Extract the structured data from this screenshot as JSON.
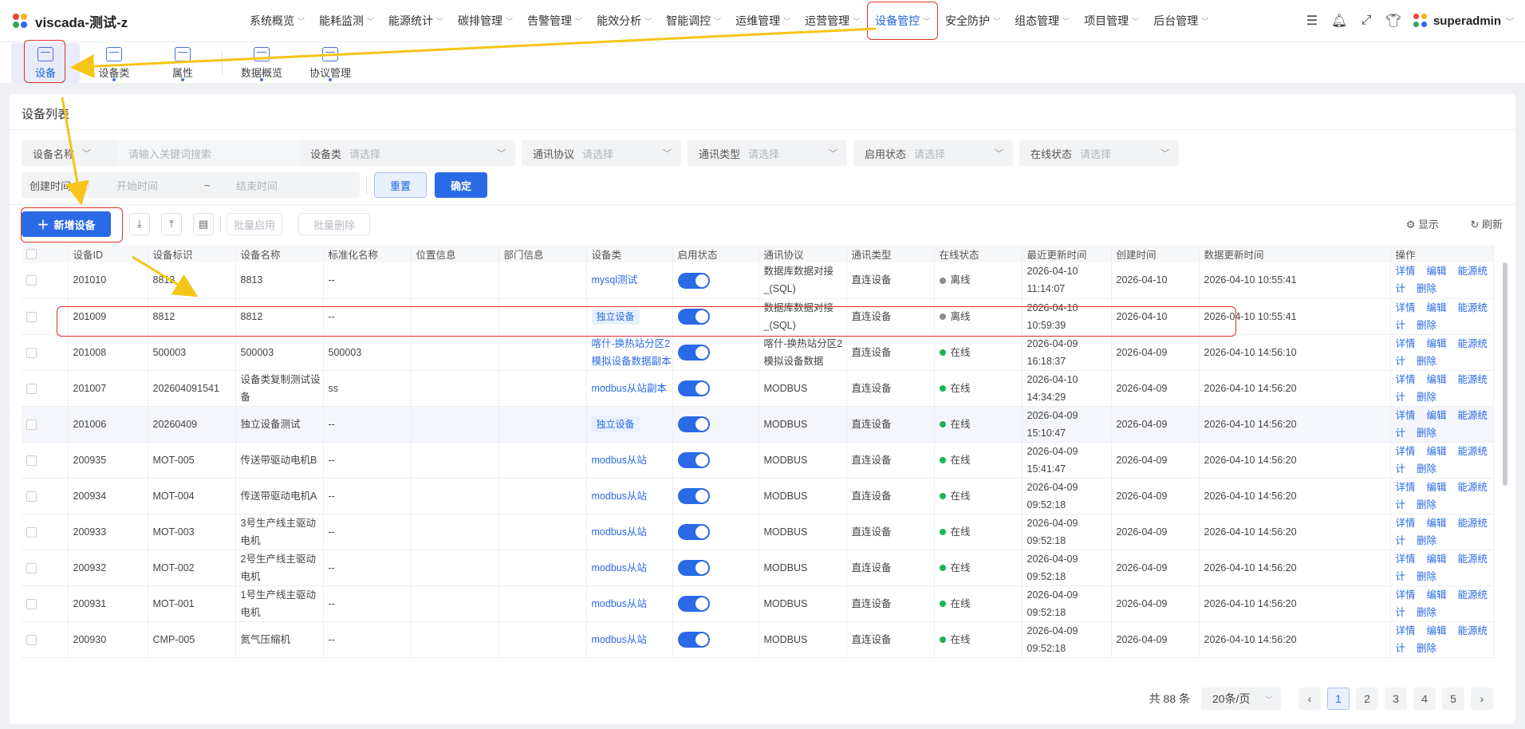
{
  "app": {
    "title": "viscada-测试-z",
    "user": "superadmin"
  },
  "nav": [
    {
      "label": "系统概览"
    },
    {
      "label": "能耗监测"
    },
    {
      "label": "能源统计"
    },
    {
      "label": "碳排管理"
    },
    {
      "label": "告警管理"
    },
    {
      "label": "能效分析"
    },
    {
      "label": "智能调控"
    },
    {
      "label": "运维管理"
    },
    {
      "label": "运营管理"
    },
    {
      "label": "设备管控",
      "active": true
    },
    {
      "label": "安全防护"
    },
    {
      "label": "组态管理"
    },
    {
      "label": "项目管理"
    },
    {
      "label": "后台管理"
    }
  ],
  "top_tools": [
    "list-icon",
    "bell-icon",
    "fullscreen-icon",
    "shirt-icon"
  ],
  "subnav": [
    {
      "label": "设备",
      "active": true
    },
    {
      "label": "设备类"
    },
    {
      "label": "属性"
    },
    {
      "label": "数据概览"
    },
    {
      "label": "协议管理"
    }
  ],
  "panel": {
    "title": "设备列表"
  },
  "filters": {
    "name_select": "设备名称",
    "keyword_placeholder": "请输入关键词搜索",
    "device_class": {
      "label": "设备类",
      "placeholder": "请选择"
    },
    "protocol": {
      "label": "通讯协议",
      "placeholder": "请选择"
    },
    "comm_type": {
      "label": "通讯类型",
      "placeholder": "请选择"
    },
    "enable_state": {
      "label": "启用状态",
      "placeholder": "请选择"
    },
    "online_state": {
      "label": "在线状态",
      "placeholder": "请选择"
    },
    "created": {
      "label": "创建时间",
      "start": "开始时间",
      "sep": "~",
      "end": "结束时间"
    },
    "reset": "重置",
    "confirm": "确定"
  },
  "toolbar": {
    "add": "新增设备",
    "batch_enable": "批量启用",
    "batch_delete": "批量删除",
    "display": "显示",
    "refresh": "刷新"
  },
  "table": {
    "columns": [
      "设备ID",
      "设备标识",
      "设备名称",
      "标准化名称",
      "位置信息",
      "部门信息",
      "设备类",
      "启用状态",
      "通讯协议",
      "通讯类型",
      "在线状态",
      "最近更新时间",
      "创建时间",
      "数据更新时间",
      "操作"
    ],
    "actions": [
      "详情",
      "编辑",
      "能源统计",
      "删除"
    ],
    "rows": [
      {
        "id": "201010",
        "tag": "8813",
        "name": "8813",
        "std": "--",
        "loc": "",
        "dept": "",
        "cls": "mysql测试",
        "cls_style": "link",
        "proto": "数据库数据对接_(SQL)",
        "ctype": "直连设备",
        "online": "离线",
        "updated": "2026-04-10 11:14:07",
        "created": "2026-04-10",
        "data_updated": "2026-04-10 10:55:41"
      },
      {
        "id": "201009",
        "tag": "8812",
        "name": "8812",
        "std": "--",
        "loc": "",
        "dept": "",
        "cls": "独立设备",
        "cls_style": "tag",
        "proto": "数据库数据对接_(SQL)",
        "ctype": "直连设备",
        "online": "离线",
        "updated": "2026-04-10 10:59:39",
        "created": "2026-04-10",
        "data_updated": "2026-04-10 10:55:41"
      },
      {
        "id": "201008",
        "tag": "500003",
        "name": "500003",
        "std": "500003",
        "loc": "",
        "dept": "",
        "cls": "喀什-换热站分区2模拟设备数据副本",
        "cls_style": "link",
        "proto": "喀什-换热站分区2模拟设备数据",
        "ctype": "直连设备",
        "online": "在线",
        "updated": "2026-04-09 16:18:37",
        "created": "2026-04-09",
        "data_updated": "2026-04-10 14:56:10"
      },
      {
        "id": "201007",
        "tag": "202604091541",
        "name": "设备类复制测试设备",
        "std": "ss",
        "loc": "",
        "dept": "",
        "cls": "modbus从站副本",
        "cls_style": "link",
        "proto": "MODBUS",
        "ctype": "直连设备",
        "online": "在线",
        "updated": "2026-04-10 14:34:29",
        "created": "2026-04-09",
        "data_updated": "2026-04-10 14:56:20"
      },
      {
        "id": "201006",
        "tag": "20260409",
        "name": "独立设备测试",
        "std": "--",
        "loc": "",
        "dept": "",
        "cls": "独立设备",
        "cls_style": "tag",
        "proto": "MODBUS",
        "ctype": "直连设备",
        "online": "在线",
        "updated": "2026-04-09 15:10:47",
        "created": "2026-04-09",
        "data_updated": "2026-04-10 14:56:20"
      },
      {
        "id": "200935",
        "tag": "MOT-005",
        "name": "传送带驱动电机B",
        "std": "--",
        "loc": "",
        "dept": "",
        "cls": "modbus从站",
        "cls_style": "link",
        "proto": "MODBUS",
        "ctype": "直连设备",
        "online": "在线",
        "updated": "2026-04-09 15:41:47",
        "created": "2026-04-09",
        "data_updated": "2026-04-10 14:56:20"
      },
      {
        "id": "200934",
        "tag": "MOT-004",
        "name": "传送带驱动电机A",
        "std": "--",
        "loc": "",
        "dept": "",
        "cls": "modbus从站",
        "cls_style": "link",
        "proto": "MODBUS",
        "ctype": "直连设备",
        "online": "在线",
        "updated": "2026-04-09 09:52:18",
        "created": "2026-04-09",
        "data_updated": "2026-04-10 14:56:20"
      },
      {
        "id": "200933",
        "tag": "MOT-003",
        "name": "3号生产线主驱动电机",
        "std": "--",
        "loc": "",
        "dept": "",
        "cls": "modbus从站",
        "cls_style": "link",
        "proto": "MODBUS",
        "ctype": "直连设备",
        "online": "在线",
        "updated": "2026-04-09 09:52:18",
        "created": "2026-04-09",
        "data_updated": "2026-04-10 14:56:20"
      },
      {
        "id": "200932",
        "tag": "MOT-002",
        "name": "2号生产线主驱动电机",
        "std": "--",
        "loc": "",
        "dept": "",
        "cls": "modbus从站",
        "cls_style": "link",
        "proto": "MODBUS",
        "ctype": "直连设备",
        "online": "在线",
        "updated": "2026-04-09 09:52:18",
        "created": "2026-04-09",
        "data_updated": "2026-04-10 14:56:20"
      },
      {
        "id": "200931",
        "tag": "MOT-001",
        "name": "1号生产线主驱动电机",
        "std": "--",
        "loc": "",
        "dept": "",
        "cls": "modbus从站",
        "cls_style": "link",
        "proto": "MODBUS",
        "ctype": "直连设备",
        "online": "在线",
        "updated": "2026-04-09 09:52:18",
        "created": "2026-04-09",
        "data_updated": "2026-04-10 14:56:20"
      },
      {
        "id": "200930",
        "tag": "CMP-005",
        "name": "氮气压缩机",
        "std": "--",
        "loc": "",
        "dept": "",
        "cls": "modbus从站",
        "cls_style": "link",
        "proto": "MODBUS",
        "ctype": "直连设备",
        "online": "在线",
        "updated": "2026-04-09 09:52:18",
        "created": "2026-04-09",
        "data_updated": "2026-04-10 14:56:20"
      }
    ]
  },
  "pagination": {
    "total": "共 88 条",
    "page_size": "20条/页",
    "pages": [
      "1",
      "2",
      "3",
      "4",
      "5"
    ],
    "current": "1"
  },
  "colors": {
    "accent": "#2a6ae6",
    "online": "#19b45a",
    "offline": "#8c8c8c",
    "annotation": "#f5c518",
    "highlight": "#e0312a"
  }
}
